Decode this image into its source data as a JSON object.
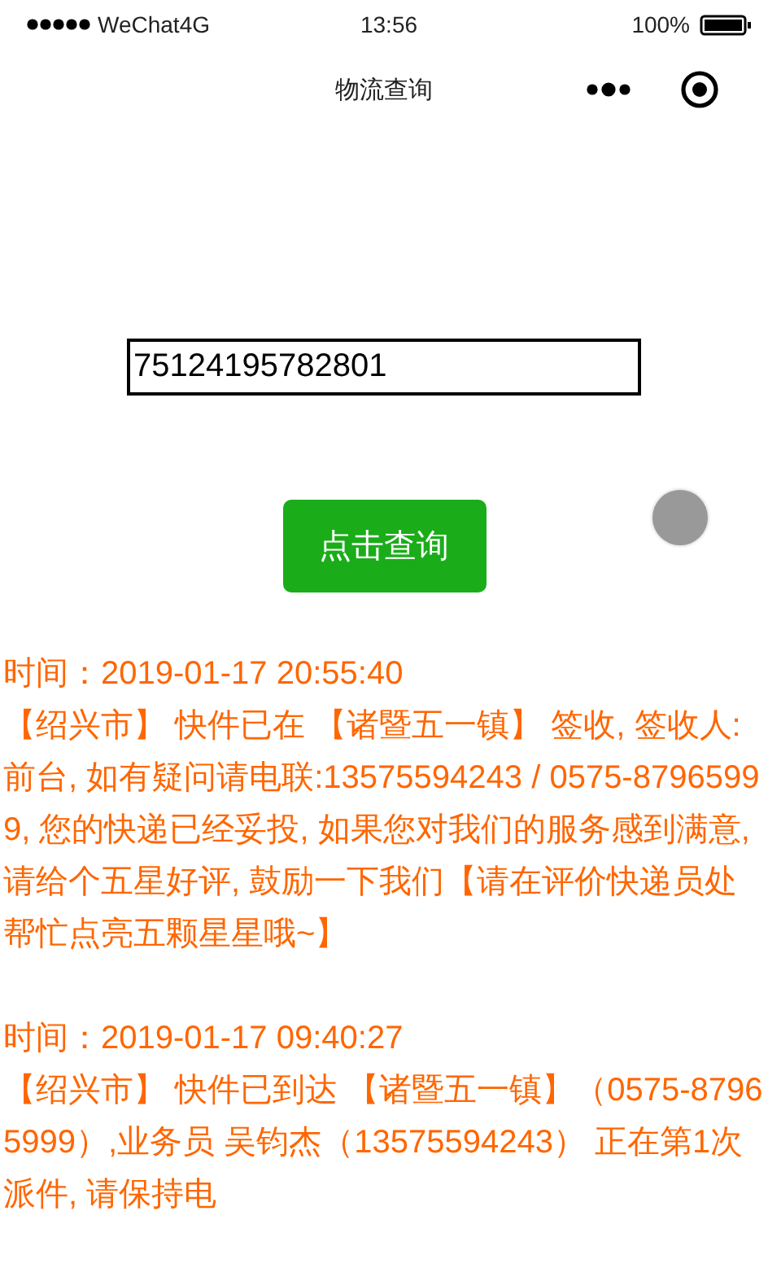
{
  "status_bar": {
    "carrier": "WeChat4G",
    "time": "13:56",
    "battery": "100%"
  },
  "nav_bar": {
    "title": "物流查询"
  },
  "query": {
    "value": "75124195782801",
    "button": "点击查询"
  },
  "records": [
    {
      "time": "时间：2019-01-17 20:55:40",
      "detail": "【绍兴市】 快件已在 【诸暨五一镇】 签收, 签收人: 前台, 如有疑问请电联:13575594243 / 0575-87965999, 您的快递已经妥投, 如果您对我们的服务感到满意, 请给个五星好评, 鼓励一下我们【请在评价快递员处帮忙点亮五颗星星哦~】"
    },
    {
      "time": "时间：2019-01-17 09:40:27",
      "detail": "【绍兴市】 快件已到达 【诸暨五一镇】（0575-87965999）,业务员 吴钧杰（13575594243） 正在第1次派件, 请保持电"
    }
  ]
}
